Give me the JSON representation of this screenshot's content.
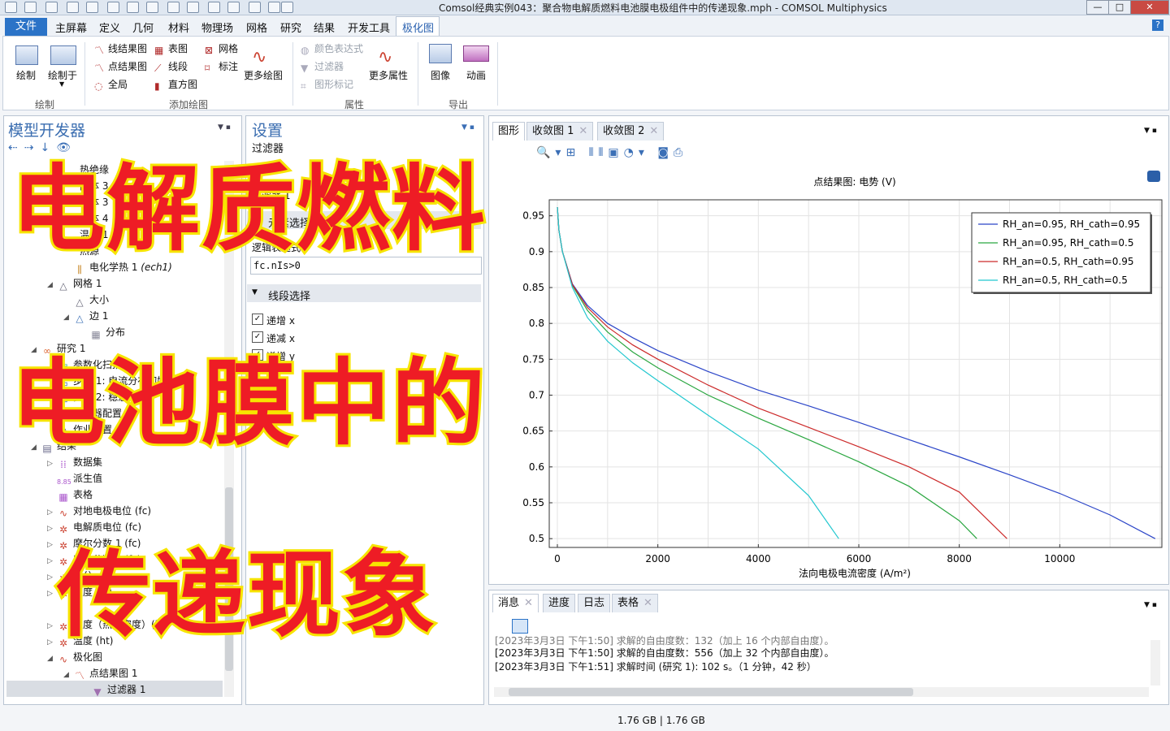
{
  "window": {
    "title": "Comsol经典实例043：聚合物电解质燃料电池膜电极组件中的传递现象.mph - COMSOL Multiphysics",
    "min": "—",
    "max": "□",
    "close": "✕"
  },
  "menu": {
    "file": "文件",
    "tabs": [
      "主屏幕",
      "定义",
      "几何",
      "材料",
      "物理场",
      "网格",
      "研究",
      "结果",
      "开发工具",
      "极化图"
    ],
    "help": "?"
  },
  "ribbon": {
    "plot": "绘制",
    "plot_in": "绘制于",
    "line_graph": "线结果图",
    "point_graph": "点结果图",
    "global": "全局",
    "table_graph": "表图",
    "line_seg": "线段",
    "histogram": "直方图",
    "mesh": "网格",
    "annotation": "标注",
    "more_plots": "更多绘图",
    "color_expr": "颜色表达式",
    "filter": "过滤器",
    "graph_marker": "图形标记",
    "more_attrs": "更多属性",
    "image": "图像",
    "animation": "动画",
    "groups": {
      "plot": "绘制",
      "add_plot": "添加绘图",
      "attrs": "属性",
      "export": "导出"
    }
  },
  "model_builder": {
    "title": "模型开发器",
    "items": [
      {
        "label": "热绝缘"
      },
      {
        "label": "固体 3"
      },
      {
        "label": "固体 3"
      },
      {
        "label": "固体 4"
      },
      {
        "label": "温度 1"
      },
      {
        "label": "热源"
      },
      {
        "label": "电化学热 1",
        "tag": "(ech1)"
      },
      {
        "label": "网格 1"
      },
      {
        "label": "大小"
      },
      {
        "label": "边 1"
      },
      {
        "label": "分布"
      },
      {
        "label": "研究 1"
      },
      {
        "label": "参数化扫描"
      },
      {
        "label": "步骤 1: 电流分布初始化"
      },
      {
        "label": "步骤 2: 稳态"
      },
      {
        "label": "求解器配置"
      },
      {
        "label": "作业配置"
      },
      {
        "label": "结果"
      },
      {
        "label": "数据集"
      },
      {
        "label": "派生值"
      },
      {
        "label": "表格"
      },
      {
        "label": "对地电极电位 (fc)"
      },
      {
        "label": "电解质电位 (fc)"
      },
      {
        "label": "摩尔分数 1 (fc)"
      },
      {
        "label": "摩尔分数 2 (fc)"
      },
      {
        "label": "水分"
      },
      {
        "label": "温度 (fc)"
      },
      {
        "label": "温度（热流密度）(ht)"
      },
      {
        "label": "温度 (ht)"
      },
      {
        "label": "极化图"
      },
      {
        "label": "点结果图 1"
      },
      {
        "label": "过滤器 1"
      }
    ]
  },
  "settings": {
    "title": "设置",
    "sub_title": "过滤器",
    "name_value": "过滤器 1",
    "section_filter": "元素选择",
    "logical_label": "逻辑表达式",
    "expression": "fc.nIs>0",
    "section_segments": "线段选择",
    "cb1": "递增 x",
    "cb2": "递减 x",
    "cb3": "递增 y"
  },
  "graphics": {
    "tabs": [
      "图形",
      "收敛图 1",
      "收敛图 2"
    ]
  },
  "chart_data": {
    "type": "line",
    "title": "点结果图: 电势 (V)",
    "xlabel": "法向电极电流密度 (A/m²)",
    "ylabel": "",
    "xlim": [
      0,
      12000
    ],
    "ylim": [
      0.49,
      0.97
    ],
    "xticks": [
      0,
      2000,
      4000,
      6000,
      8000,
      10000
    ],
    "yticks": [
      0.5,
      0.55,
      0.6,
      0.65,
      0.7,
      0.75,
      0.8,
      0.85,
      0.9,
      0.95
    ],
    "ytick_labels": [
      "0.5",
      "0.55",
      "0.6",
      "0.65",
      "0.7",
      "0.75",
      "0.8",
      "0.85",
      "0.9",
      "0.95"
    ],
    "grid": true,
    "legend_position": "top-right",
    "series": [
      {
        "name": "RH_an=0.95, RH_cath=0.95",
        "color": "#2b45c8",
        "x": [
          0,
          30,
          100,
          300,
          600,
          1000,
          1500,
          2000,
          3000,
          4000,
          5000,
          6000,
          7000,
          8000,
          9000,
          10000,
          11000,
          11900
        ],
        "y": [
          0.962,
          0.93,
          0.9,
          0.855,
          0.825,
          0.8,
          0.78,
          0.762,
          0.733,
          0.707,
          0.685,
          0.662,
          0.638,
          0.614,
          0.589,
          0.563,
          0.533,
          0.5
        ]
      },
      {
        "name": "RH_an=0.95, RH_cath=0.5",
        "color": "#2aa640",
        "x": [
          0,
          30,
          100,
          300,
          600,
          1000,
          1500,
          2000,
          3000,
          4000,
          5000,
          6000,
          7000,
          8000,
          8350
        ],
        "y": [
          0.962,
          0.93,
          0.9,
          0.853,
          0.818,
          0.788,
          0.76,
          0.738,
          0.7,
          0.668,
          0.638,
          0.607,
          0.573,
          0.525,
          0.5
        ]
      },
      {
        "name": "RH_an=0.5, RH_cath=0.95",
        "color": "#cc2a2a",
        "x": [
          0,
          30,
          100,
          300,
          600,
          1000,
          1500,
          2000,
          3000,
          4000,
          5000,
          6000,
          7000,
          8000,
          8950
        ],
        "y": [
          0.962,
          0.93,
          0.9,
          0.854,
          0.822,
          0.795,
          0.77,
          0.75,
          0.714,
          0.682,
          0.655,
          0.628,
          0.6,
          0.565,
          0.5
        ]
      },
      {
        "name": "RH_an=0.5, RH_cath=0.5",
        "color": "#22c7cf",
        "x": [
          0,
          30,
          100,
          300,
          600,
          1000,
          1500,
          2000,
          3000,
          4000,
          5000,
          5600
        ],
        "y": [
          0.962,
          0.93,
          0.9,
          0.85,
          0.808,
          0.775,
          0.745,
          0.72,
          0.672,
          0.625,
          0.56,
          0.5
        ]
      }
    ]
  },
  "messages": {
    "tabs": [
      "消息",
      "进度",
      "日志",
      "表格"
    ],
    "lines": [
      "[2023年3月3日 下午1:50] 求解的自由度数：132（加上 16 个内部自由度）。",
      "[2023年3月3日 下午1:50] 求解的自由度数：556（加上 32 个内部自由度）。",
      "[2023年3月3日 下午1:51] 求解时间 (研究 1): 102 s。（1 分钟，42 秒）"
    ]
  },
  "status_bar": "1.76 GB | 1.76 GB",
  "overlay": {
    "line1": "电解质燃料",
    "line2": "电池膜中的",
    "line3": "传递现象"
  }
}
